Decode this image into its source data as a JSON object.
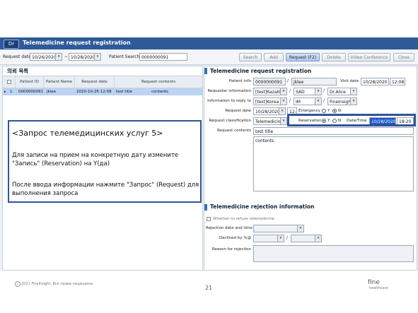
{
  "window": {
    "app_icon": "Dr",
    "title": "Telemedicine request registration"
  },
  "toolbar": {
    "request_date_label": "Request date",
    "date_from": "10/26/2020",
    "date_sep": "~",
    "date_to": "10/28/2020",
    "patient_search_label": "Patient Search",
    "patient_search_value": "0000000091",
    "buttons": {
      "search": "Search",
      "add": "Add",
      "request": "Request (F2)",
      "delete": "Delete",
      "video": "Video Conference",
      "close": "Close"
    }
  },
  "left": {
    "section_title": "의뢰 목록",
    "columns": [
      "",
      "Patient ID",
      "Patient Name",
      "Request date",
      "Request contents"
    ],
    "rows": [
      {
        "marker": "▸",
        "num": "1",
        "patient_id": "0000000091",
        "patient_name": "jklee",
        "request_date": "2020-10-26 12:08",
        "title": "test title",
        "contents": "contents"
      }
    ]
  },
  "callout": {
    "title": "<Запрос телемедицинских услуг 5>",
    "line1": "Для записи на прием на конкретную дату измените",
    "line2": "\"Запись\" (Reservation) на Y(да)",
    "line3": "После ввода информации нажмите \"Запрос\" (Request) для",
    "line4": "выполнения запроса"
  },
  "request_form": {
    "section_title": "Telemedicine request registration",
    "patient_info_label": "Patient info",
    "patient_id": "0000000091",
    "patient_sep": "/",
    "patient_name": "jklee",
    "visit_date_label": "Visit date",
    "visit_date": "10/28/2020",
    "visit_time": "12:08",
    "requester_label": "Requester information",
    "requester_org": "[test]Kazakhs",
    "requester_dept": "SAD",
    "requester_doctor": "Dr.Alice",
    "reply_label": "Information to reply to",
    "reply_org": "[test]Korea",
    "reply_dept": "IM",
    "reply_doctor": "FineInsight",
    "request_date_label": "Request date",
    "request_date": "10/28/2020",
    "request_time": "12:08",
    "emergency_label": "Emergency",
    "emergency_y": "Y",
    "emergency_n": "N",
    "classification_label": "Request classification",
    "classification": "Telemedicine",
    "reservation_label": "Reservation",
    "reservation_y": "Y",
    "reservation_n": "N",
    "datetime_label": "Date/Time",
    "res_date": "10/28/2020",
    "res_time": "18:20",
    "contents_label": "Request contents",
    "contents_title": "test title",
    "contents_body": "contents"
  },
  "rejection": {
    "section_title": "Telemedicine rejection information",
    "refuse_label": "Whether to refuse telemedicine",
    "date_time_label": "Rejection date and time",
    "declined_label": "Declined by %@",
    "reason_label": "Reason for rejection"
  },
  "footer": {
    "copyright": "2021 FineInsight, Все права защищены",
    "page": "21",
    "logo": "fine",
    "logo_sub": "healthcare"
  },
  "colors": {
    "title_bar": "#2e5a9a",
    "highlight_border": "#2f5597",
    "selected_row": "#bcd3f2"
  }
}
